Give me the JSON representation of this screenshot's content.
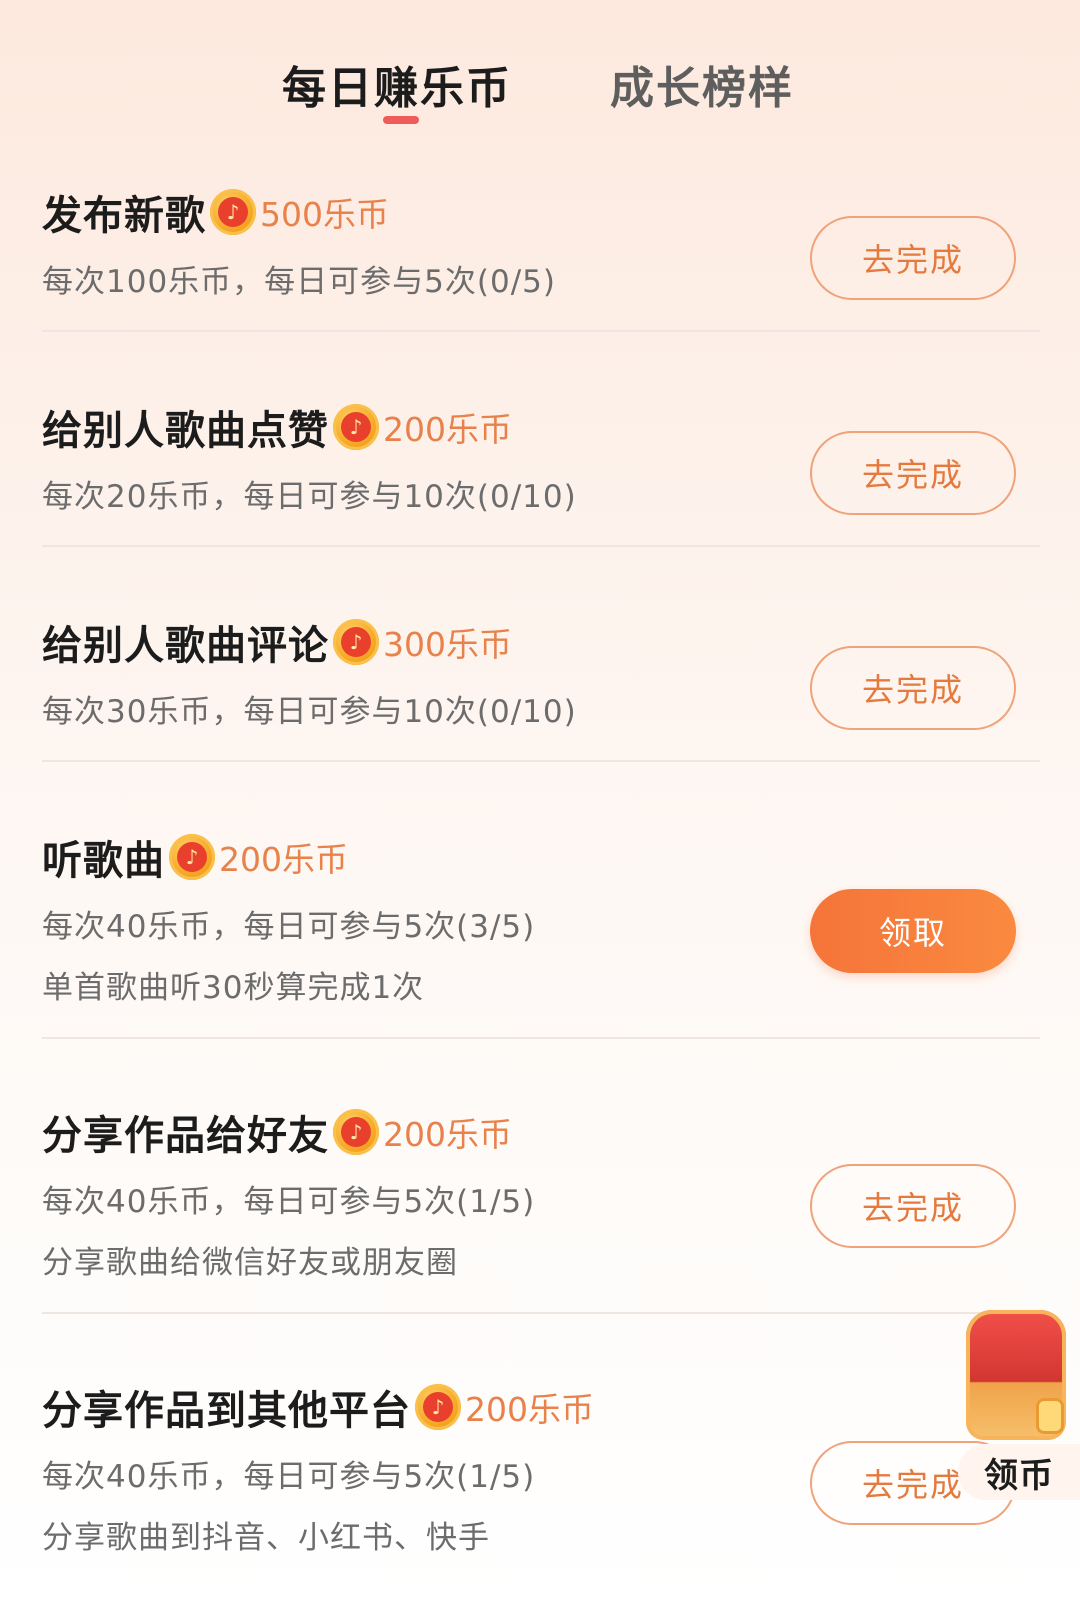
{
  "tabs": {
    "active": "每日赚乐币",
    "inactive": "成长榜样"
  },
  "tasks": [
    {
      "title": "发布新歌",
      "reward": "500乐币",
      "desc1": "每次100乐币，每日可参与5次(0/5)",
      "desc2": "",
      "button": "去完成",
      "button_style": "outline"
    },
    {
      "title": "给别人歌曲点赞",
      "reward": "200乐币",
      "desc1": "每次20乐币，每日可参与10次(0/10)",
      "desc2": "",
      "button": "去完成",
      "button_style": "outline"
    },
    {
      "title": "给别人歌曲评论",
      "reward": "300乐币",
      "desc1": "每次30乐币，每日可参与10次(0/10)",
      "desc2": "",
      "button": "去完成",
      "button_style": "outline"
    },
    {
      "title": "听歌曲",
      "reward": "200乐币",
      "desc1": "每次40乐币，每日可参与5次(3/5)",
      "desc2": "单首歌曲听30秒算完成1次",
      "button": "领取",
      "button_style": "filled"
    },
    {
      "title": "分享作品给好友",
      "reward": "200乐币",
      "desc1": "每次40乐币，每日可参与5次(1/5)",
      "desc2": "分享歌曲给微信好友或朋友圈",
      "button": "去完成",
      "button_style": "outline"
    },
    {
      "title": "分享作品到其他平台",
      "reward": "200乐币",
      "desc1": "每次40乐币，每日可参与5次(1/5)",
      "desc2": "分享歌曲到抖音、小红书、快手",
      "button": "去完成",
      "button_style": "outline"
    }
  ],
  "floating": {
    "label": "领币",
    "icon": "treasure-chest-icon"
  },
  "coin_icon": "music-coin-icon",
  "colors": {
    "accent_orange": "#e57a3e",
    "indicator_red": "#ef5b5b",
    "button_fill": "#f5743a"
  }
}
